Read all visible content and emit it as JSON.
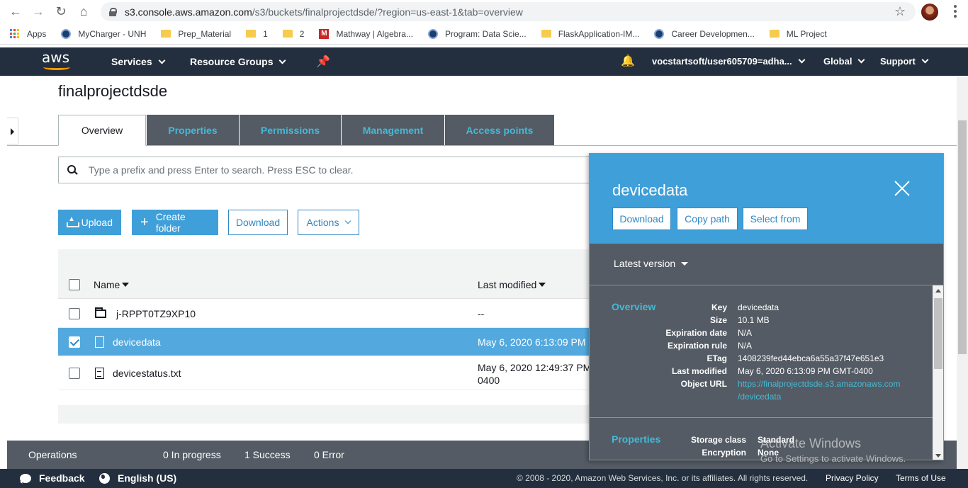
{
  "browser": {
    "url_host": "s3.console.aws.amazon.com",
    "url_path": "/s3/buckets/finalprojectdsde/?region=us-east-1&tab=overview",
    "bookmarks": [
      "Apps",
      "MyCharger - UNH",
      "Prep_Material",
      "1",
      "2",
      "Mathway | Algebra...",
      "Program: Data Scie...",
      "FlaskApplication-IM...",
      "Career Developmen...",
      "ML Project"
    ]
  },
  "awsnav": {
    "logo": "aws",
    "services": "Services",
    "resource_groups": "Resource Groups",
    "account": "vocstartsoft/user605709=adha...",
    "region": "Global",
    "support": "Support"
  },
  "bucket": {
    "title": "finalprojectdsde",
    "tabs": [
      "Overview",
      "Properties",
      "Permissions",
      "Management",
      "Access points"
    ]
  },
  "search": {
    "placeholder": "Type a prefix and press Enter to search. Press ESC to clear."
  },
  "toolbar": {
    "upload": "Upload",
    "create_folder": "Create folder",
    "download": "Download",
    "actions": "Actions"
  },
  "table": {
    "col_name": "Name",
    "col_modified": "Last modified",
    "rows": [
      {
        "name": "j-RPPT0TZ9XP10",
        "modified": "--",
        "modified2": ""
      },
      {
        "name": "devicedata",
        "modified": "May 6, 2020 6:13:09 PM",
        "modified2": ""
      },
      {
        "name": "devicestatus.txt",
        "modified": "May 6, 2020 12:49:37 PM",
        "modified2": "0400"
      }
    ]
  },
  "panel": {
    "title": "devicedata",
    "download": "Download",
    "copy_path": "Copy path",
    "select_from": "Select from",
    "version": "Latest version",
    "overview_title": "Overview",
    "overview": [
      {
        "key": "Key",
        "value": "devicedata"
      },
      {
        "key": "Size",
        "value": "10.1 MB"
      },
      {
        "key": "Expiration date",
        "value": "N/A"
      },
      {
        "key": "Expiration rule",
        "value": "N/A"
      },
      {
        "key": "ETag",
        "value": "1408239fed44ebca6a55a37f47e651e3"
      },
      {
        "key": "Last modified",
        "value": "May 6, 2020 6:13:09 PM GMT-0400"
      },
      {
        "key": "Object URL",
        "value": "https://finalprojectdsde.s3.amazonaws.com",
        "value2": "/devicedata"
      }
    ],
    "properties_title": "Properties",
    "properties": [
      {
        "key": "Storage class",
        "value": "Standard"
      },
      {
        "key": "Encryption",
        "value": "None"
      }
    ]
  },
  "operations": {
    "label": "Operations",
    "in_progress": "0 In progress",
    "success": "1 Success",
    "error": "0 Error"
  },
  "footer": {
    "feedback": "Feedback",
    "language": "English (US)",
    "copyright": "© 2008 - 2020, Amazon Web Services, Inc. or its affiliates. All rights reserved.",
    "privacy": "Privacy Policy",
    "terms": "Terms of Use"
  },
  "watermark": {
    "line1": "Activate Windows",
    "line2": "Go to Settings to activate Windows."
  }
}
